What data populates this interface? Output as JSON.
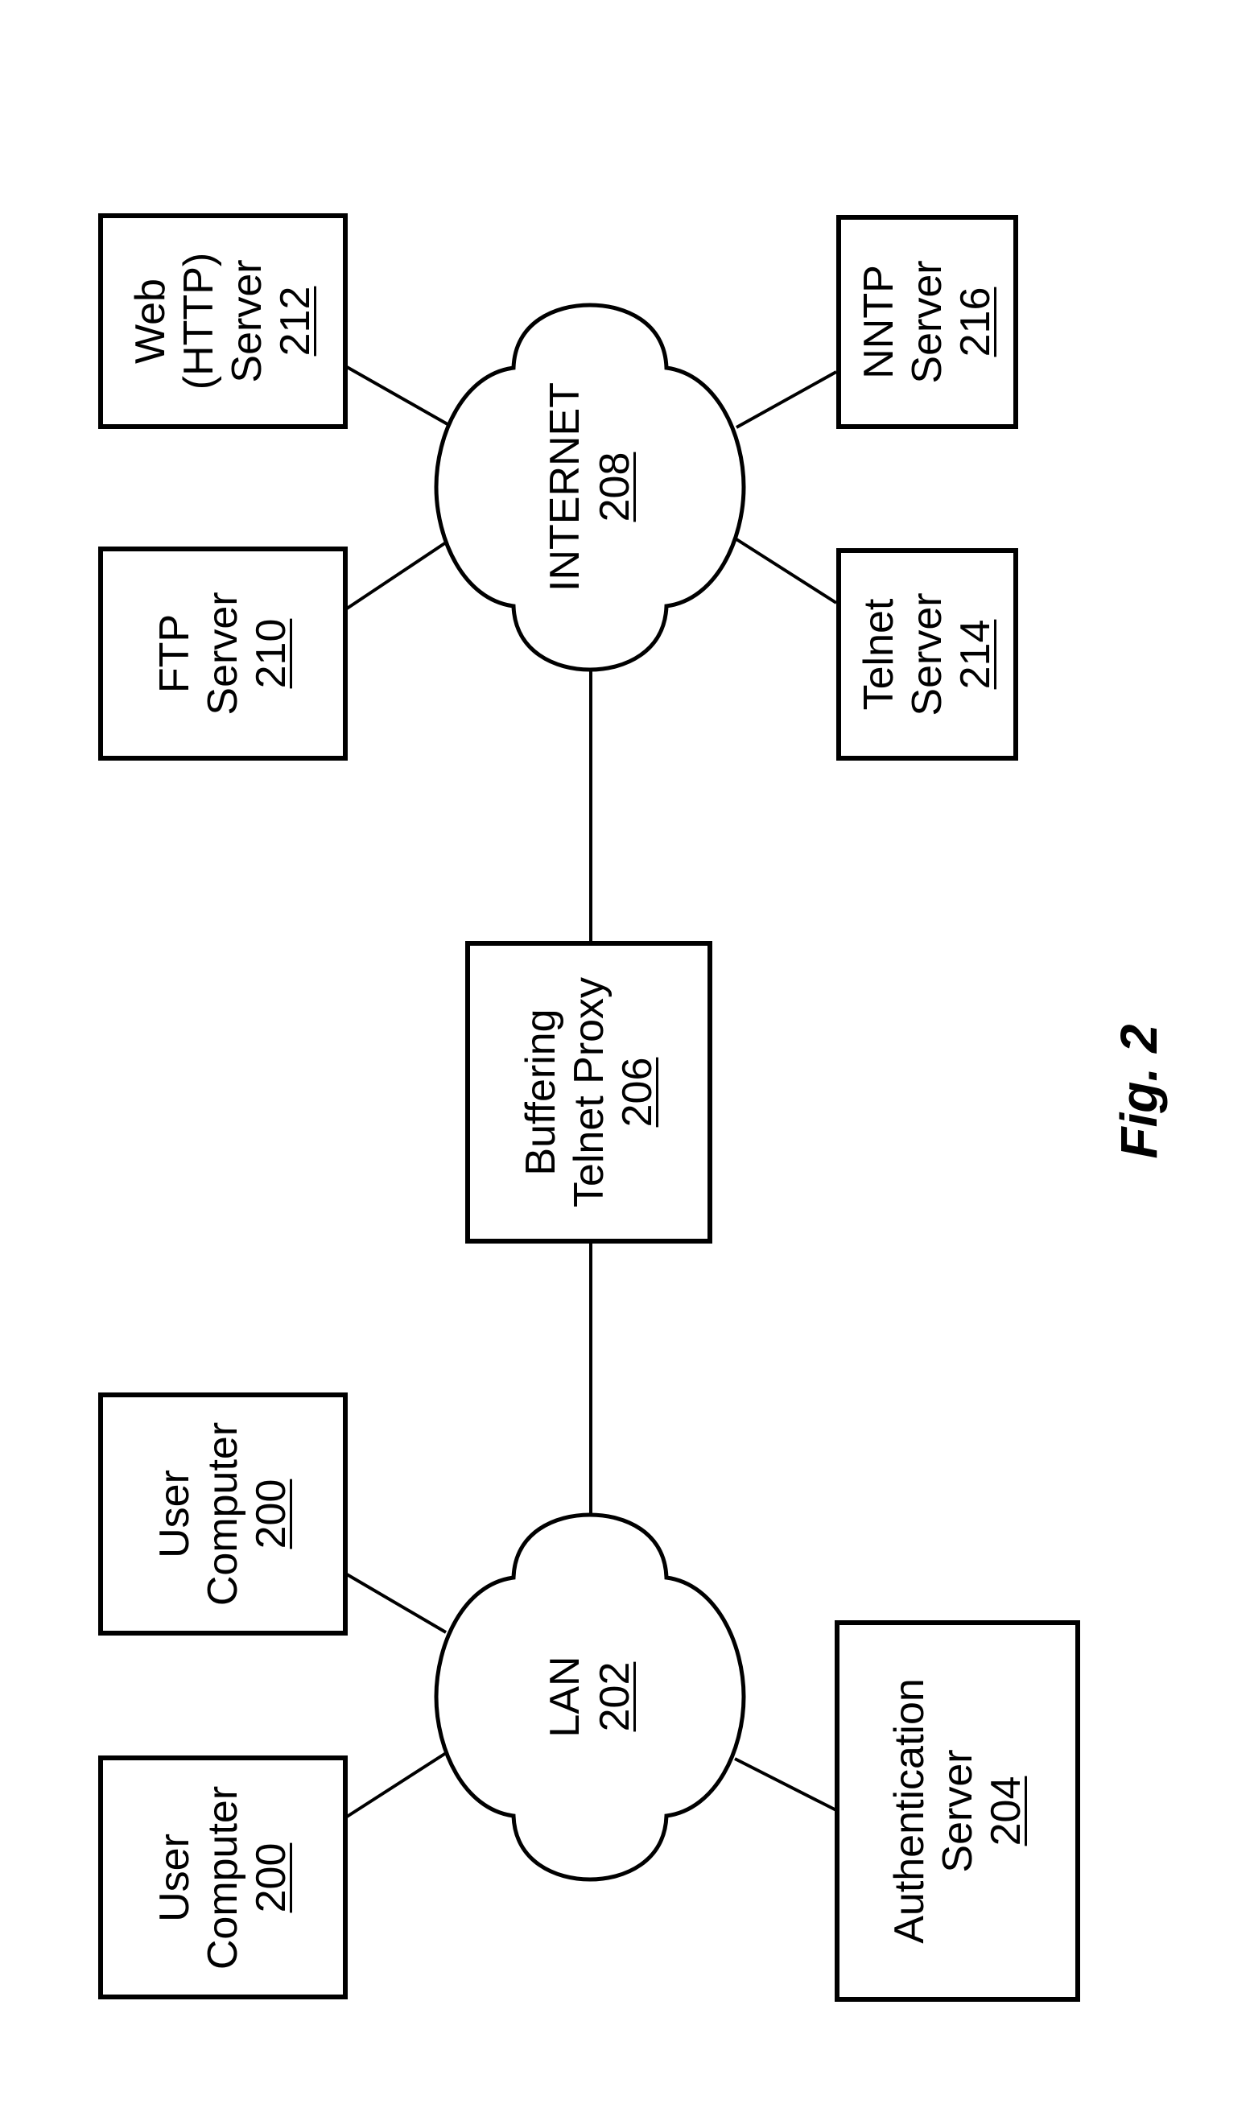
{
  "figure": {
    "label": "Fig. 2"
  },
  "nodes": {
    "web_server": {
      "lines": [
        "Web",
        "(HTTP)",
        "Server"
      ],
      "ref": "212"
    },
    "ftp_server": {
      "lines": [
        "FTP",
        "Server"
      ],
      "ref": "210"
    },
    "nntp_server": {
      "lines": [
        "NNTP",
        "Server"
      ],
      "ref": "216"
    },
    "telnet_server": {
      "lines": [
        "Telnet",
        "Server"
      ],
      "ref": "214"
    },
    "internet": {
      "lines": [
        "INTERNET"
      ],
      "ref": "208"
    },
    "proxy": {
      "lines": [
        "Buffering",
        "Telnet Proxy"
      ],
      "ref": "206"
    },
    "user_computer_a": {
      "lines": [
        "User",
        "Computer"
      ],
      "ref": "200"
    },
    "user_computer_b": {
      "lines": [
        "User",
        "Computer"
      ],
      "ref": "200"
    },
    "lan": {
      "lines": [
        "LAN"
      ],
      "ref": "202"
    },
    "auth_server": {
      "lines": [
        "Authentication",
        "Server"
      ],
      "ref": "204"
    }
  },
  "connections": [
    [
      "web_server",
      "internet"
    ],
    [
      "ftp_server",
      "internet"
    ],
    [
      "nntp_server",
      "internet"
    ],
    [
      "telnet_server",
      "internet"
    ],
    [
      "internet",
      "proxy"
    ],
    [
      "proxy",
      "lan"
    ],
    [
      "user_computer_a",
      "lan"
    ],
    [
      "user_computer_b",
      "lan"
    ],
    [
      "auth_server",
      "lan"
    ]
  ]
}
